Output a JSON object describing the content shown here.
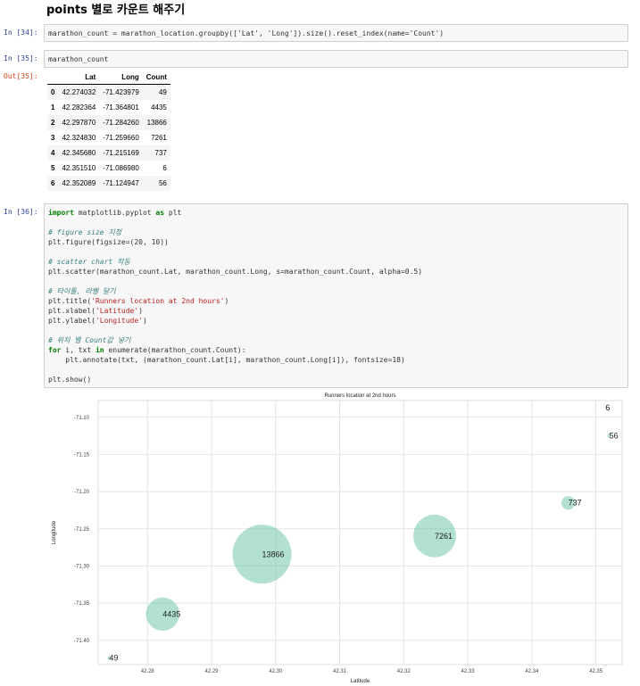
{
  "heading": "points 별로 카운트 해주기",
  "cells": [
    {
      "prompt": "In [34]:",
      "code": "marathon_count = marathon_location.groupby(['Lat', 'Long']).size().reset_index(name='Count')"
    },
    {
      "prompt": "In [35]:",
      "code": "marathon_count"
    },
    {
      "prompt": "In [36]:",
      "lines": [
        "import matplotlib.pyplot as plt",
        "",
        "# figure size 지정",
        "plt.figure(figsize=(20, 10))",
        "",
        "# scatter chart 작동",
        "plt.scatter(marathon_count.Lat, marathon_count.Long, s=marathon_count.Count, alpha=0.5)",
        "",
        "# 타이틀, 라벨 달기",
        "plt.title('Runners location at 2nd hours')",
        "plt.xlabel('Latitude')",
        "plt.ylabel('Longitude')",
        "",
        "# 위치 별 Count값 넣기",
        "for i, txt in enumerate(marathon_count.Count):",
        "    plt.annotate(txt, (marathon_count.Lat[i], marathon_count.Long[i]), fontsize=18)",
        "",
        "plt.show()"
      ]
    }
  ],
  "out_prompt": "Out[35]:",
  "table": {
    "columns": [
      "",
      "Lat",
      "Long",
      "Count"
    ],
    "rows": [
      [
        "0",
        "42.274032",
        "-71.423979",
        "49"
      ],
      [
        "1",
        "42.282364",
        "-71.364801",
        "4435"
      ],
      [
        "2",
        "42.297870",
        "-71.284260",
        "13866"
      ],
      [
        "3",
        "42.324830",
        "-71.259660",
        "7261"
      ],
      [
        "4",
        "42.345680",
        "-71.215169",
        "737"
      ],
      [
        "5",
        "42.351510",
        "-71.086980",
        "6"
      ],
      [
        "6",
        "42.352089",
        "-71.124947",
        "56"
      ]
    ]
  },
  "chart_data": {
    "type": "scatter",
    "title": "Runners location at 2nd hours",
    "xlabel": "Latitude",
    "ylabel": "Longitude",
    "xlim": [
      42.2723,
      42.3541
    ],
    "ylim": [
      -71.4327,
      -71.0775
    ],
    "xticks": [
      "42.28",
      "42.29",
      "42.30",
      "42.31",
      "42.32",
      "42.33",
      "42.34",
      "42.35"
    ],
    "yticks": [
      "-71.10",
      "-71.15",
      "-71.20",
      "-71.25",
      "-71.30",
      "-71.35",
      "-71.40"
    ],
    "grid": true,
    "color": "#66c2a5",
    "points": [
      {
        "x": 42.274032,
        "y": -71.423979,
        "count": 49,
        "label": "49"
      },
      {
        "x": 42.282364,
        "y": -71.364801,
        "count": 4435,
        "label": "4435"
      },
      {
        "x": 42.29787,
        "y": -71.28426,
        "count": 13866,
        "label": "13866"
      },
      {
        "x": 42.32483,
        "y": -71.25966,
        "count": 7261,
        "label": "7261"
      },
      {
        "x": 42.34568,
        "y": -71.215169,
        "count": 737,
        "label": "737"
      },
      {
        "x": 42.35151,
        "y": -71.08698,
        "count": 6,
        "label": "6"
      },
      {
        "x": 42.352089,
        "y": -71.124947,
        "count": 56,
        "label": "56"
      }
    ]
  }
}
